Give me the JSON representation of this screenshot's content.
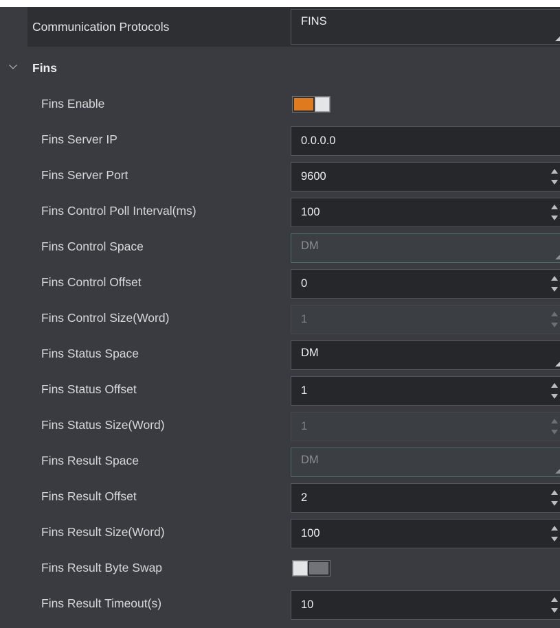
{
  "communication": {
    "label": "Communication Protocols",
    "value": "FINS"
  },
  "section": {
    "title": "Fins"
  },
  "fields": {
    "enable": {
      "label": "Fins Enable",
      "state": "on"
    },
    "server_ip": {
      "label": "Fins Server IP",
      "value": "0.0.0.0"
    },
    "server_port": {
      "label": "Fins Server Port",
      "value": "9600"
    },
    "control_poll": {
      "label": "Fins Control Poll Interval(ms)",
      "value": "100"
    },
    "control_space": {
      "label": "Fins Control Space",
      "value": "DM"
    },
    "control_offset": {
      "label": "Fins Control Offset",
      "value": "0"
    },
    "control_size": {
      "label": "Fins Control Size(Word)",
      "value": "1"
    },
    "status_space": {
      "label": "Fins Status Space",
      "value": "DM"
    },
    "status_offset": {
      "label": "Fins Status Offset",
      "value": "1"
    },
    "status_size": {
      "label": "Fins Status Size(Word)",
      "value": "1"
    },
    "result_space": {
      "label": "Fins Result Space",
      "value": "DM"
    },
    "result_offset": {
      "label": "Fins Result Offset",
      "value": "2"
    },
    "result_size": {
      "label": "Fins Result Size(Word)",
      "value": "100"
    },
    "byte_swap": {
      "label": "Fins Result Byte Swap",
      "state": "off"
    },
    "result_timeout": {
      "label": "Fins Result Timeout(s)",
      "value": "10"
    }
  },
  "colors": {
    "accent": "#e07a1f",
    "panel": "#393b40",
    "field": "#25272b"
  },
  "icons": {
    "collapse": "chevron-down-icon",
    "spin_up": "spin-up-icon",
    "spin_down": "spin-down-icon",
    "dropdown": "dropdown-corner-icon"
  }
}
